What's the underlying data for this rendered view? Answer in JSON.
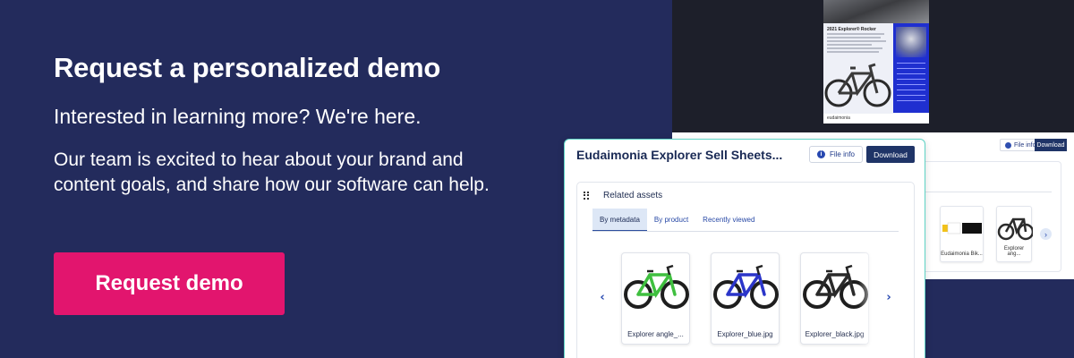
{
  "promo": {
    "headline": "Request a personalized demo",
    "subhead": "Interested in learning more? We're here.",
    "body": "Our team is excited to hear about your brand and content goals, and share how our software can help.",
    "cta_label": "Request demo"
  },
  "sell_sheet": {
    "title": "2021 Explorer® Rocker",
    "brand": "eudaimonia"
  },
  "asset_card": {
    "title": "Eudaimonia Explorer Sell Sheets...",
    "file_info_label": "File info",
    "download_label": "Download",
    "related": {
      "title": "Related assets",
      "tabs": [
        {
          "label": "By metadata",
          "active": true
        },
        {
          "label": "By product",
          "active": false
        },
        {
          "label": "Recently viewed",
          "active": false
        }
      ],
      "thumbnails": [
        {
          "caption": "Explorer angle_...",
          "frame_color": "#3fbf3f"
        },
        {
          "caption": "Explorer_blue.jpg",
          "frame_color": "#2b35c9"
        },
        {
          "caption": "Explorer_black.jpg",
          "frame_color": "#2a2a2a"
        }
      ],
      "prev_icon": "‹",
      "next_icon": "›"
    }
  },
  "background_card": {
    "file_info_label": "File info",
    "download_label": "Download",
    "thumbnails": [
      {
        "caption": "Eudaimonia Bik..."
      },
      {
        "caption": "Explorer ang..."
      }
    ],
    "next_icon": "›"
  },
  "colors": {
    "background": "#232b5c",
    "cta": "#e2156e",
    "card_border": "#5fd3c5",
    "download": "#1f3467"
  }
}
